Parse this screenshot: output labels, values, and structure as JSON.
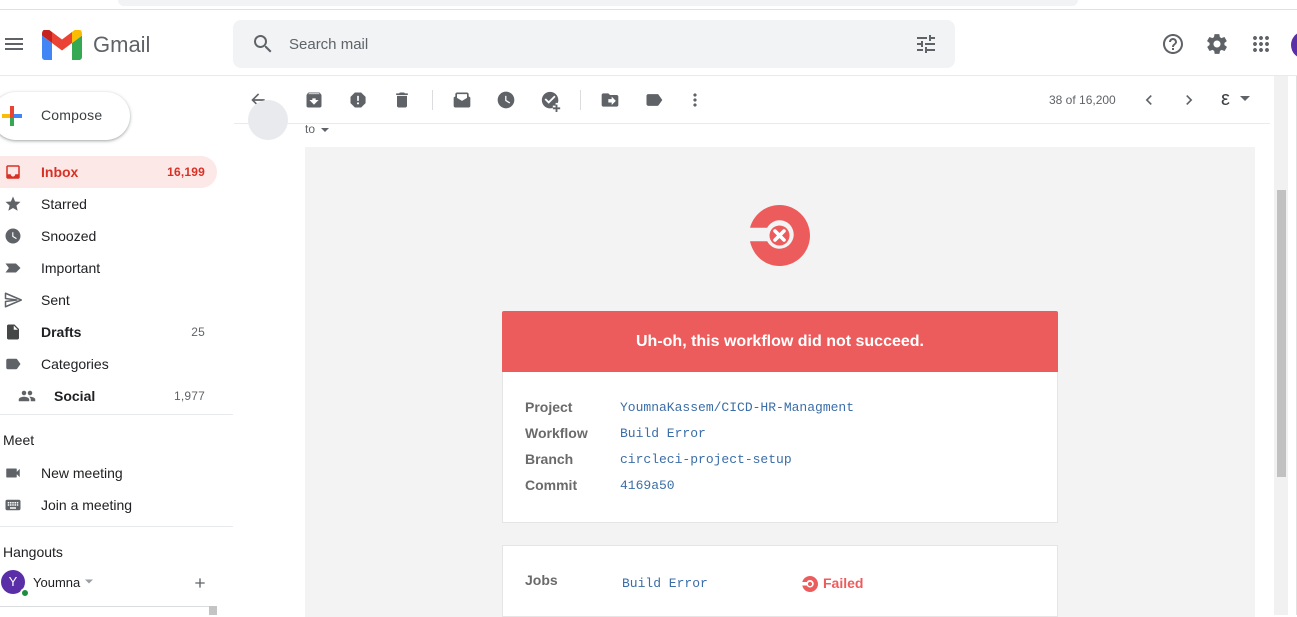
{
  "app": {
    "name": "Gmail"
  },
  "search": {
    "placeholder": "Search mail"
  },
  "sidebar": {
    "compose_label": "Compose",
    "items": [
      {
        "label": "Inbox",
        "count": "16,199",
        "icon": "inbox-icon"
      },
      {
        "label": "Starred",
        "count": "",
        "icon": "star-icon"
      },
      {
        "label": "Snoozed",
        "count": "",
        "icon": "clock-icon"
      },
      {
        "label": "Important",
        "count": "",
        "icon": "important-icon"
      },
      {
        "label": "Sent",
        "count": "",
        "icon": "send-icon"
      },
      {
        "label": "Drafts",
        "count": "25",
        "icon": "draft-icon"
      },
      {
        "label": "Categories",
        "count": "",
        "icon": "label-icon"
      },
      {
        "label": "Social",
        "count": "1,977",
        "icon": "people-icon"
      }
    ],
    "meet": {
      "title": "Meet",
      "items": [
        {
          "label": "New meeting",
          "icon": "video-icon"
        },
        {
          "label": "Join a meeting",
          "icon": "keyboard-icon"
        }
      ]
    },
    "hangouts": {
      "title": "Hangouts",
      "user_initial": "Y",
      "user_name": "Youmna"
    }
  },
  "toolbar": {
    "pager": "38 of 16,200",
    "input_tool": "ε"
  },
  "email": {
    "to_label": "to",
    "banner": "Uh-oh, this workflow did not succeed.",
    "details": [
      {
        "label": "Project",
        "value": "YoumnaKassem/CICD-HR-Managment"
      },
      {
        "label": "Workflow",
        "value": "Build Error"
      },
      {
        "label": "Branch",
        "value": "circleci-project-setup"
      },
      {
        "label": "Commit",
        "value": "4169a50"
      }
    ],
    "jobs": {
      "label": "Jobs",
      "job_name": "Build Error",
      "status": "Failed"
    }
  },
  "colors": {
    "accent_red": "#d93025",
    "circleci_red": "#ed5c5c",
    "link_blue": "#3b6ea8",
    "active_bg": "#fce8e6"
  }
}
